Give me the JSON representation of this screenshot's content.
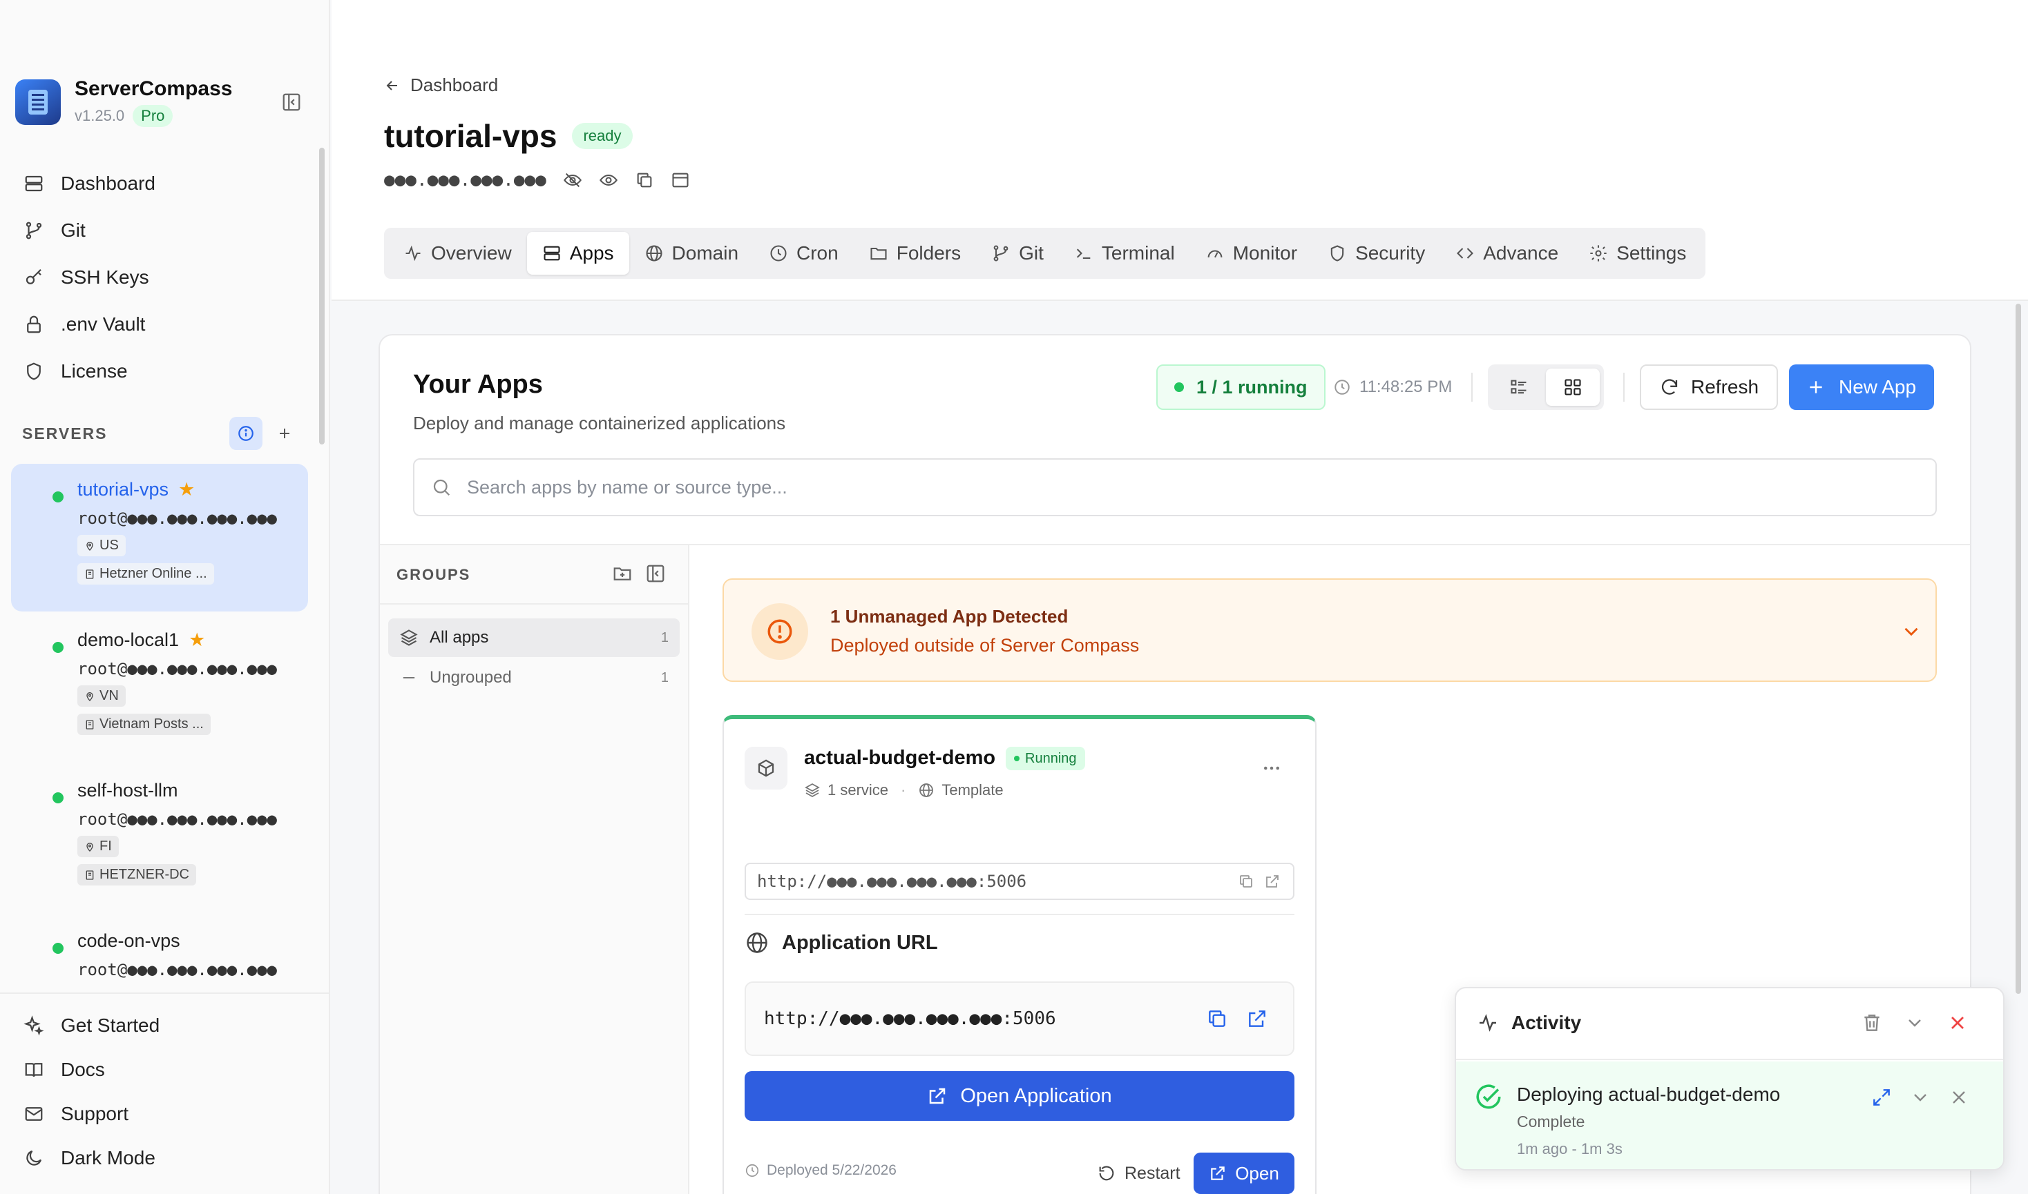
{
  "brand": {
    "name": "ServerCompass",
    "version": "v1.25.0",
    "plan": "Pro"
  },
  "nav": [
    {
      "label": "Dashboard",
      "icon": "dashboard-icon"
    },
    {
      "label": "Git",
      "icon": "git-branch-icon"
    },
    {
      "label": "SSH Keys",
      "icon": "key-icon"
    },
    {
      "label": ".env Vault",
      "icon": "lock-icon"
    },
    {
      "label": "License",
      "icon": "shield-icon"
    }
  ],
  "servers_section": {
    "label": "SERVERS"
  },
  "servers": [
    {
      "name": "tutorial-vps",
      "starred": "★",
      "address": "root@●●●.●●●.●●●.●●●",
      "country": "US",
      "provider": "Hetzner Online ...",
      "status": "online"
    },
    {
      "name": "demo-local1",
      "starred": "★",
      "address": "root@●●●.●●●.●●●.●●●",
      "country": "VN",
      "provider": "Vietnam Posts ...",
      "status": "online"
    },
    {
      "name": "self-host-llm",
      "address": "root@●●●.●●●.●●●.●●●",
      "country": "FI",
      "provider": "HETZNER-DC",
      "status": "online"
    },
    {
      "name": "code-on-vps",
      "address": "root@●●●.●●●.●●●.●●●",
      "status": "online"
    }
  ],
  "bottom_nav": [
    {
      "label": "Get Started",
      "icon": "sparkles-icon"
    },
    {
      "label": "Docs",
      "icon": "book-icon"
    },
    {
      "label": "Support",
      "icon": "mail-icon"
    },
    {
      "label": "Dark Mode",
      "icon": "moon-icon"
    }
  ],
  "header": {
    "back_label": "Dashboard",
    "title": "tutorial-vps",
    "status": "ready",
    "ip_masked": "●●●.●●●.●●●.●●●"
  },
  "tabs": [
    {
      "label": "Overview",
      "icon": "activity-icon"
    },
    {
      "label": "Apps",
      "icon": "server-icon",
      "active": true
    },
    {
      "label": "Domain",
      "icon": "globe-icon"
    },
    {
      "label": "Cron",
      "icon": "clock-icon"
    },
    {
      "label": "Folders",
      "icon": "folder-icon"
    },
    {
      "label": "Git",
      "icon": "git-branch-icon"
    },
    {
      "label": "Terminal",
      "icon": "terminal-icon"
    },
    {
      "label": "Monitor",
      "icon": "gauge-icon"
    },
    {
      "label": "Security",
      "icon": "shield-icon"
    },
    {
      "label": "Advance",
      "icon": "code-icon"
    },
    {
      "label": "Settings",
      "icon": "gear-icon"
    }
  ],
  "apps_panel": {
    "title": "Your Apps",
    "subtitle": "Deploy and manage containerized applications",
    "running": "1 / 1 running",
    "last_updated": "11:48:25 PM",
    "refresh_label": "Refresh",
    "new_app_label": "New App",
    "search_placeholder": "Search apps by name or source type..."
  },
  "groups": {
    "label": "GROUPS",
    "items": [
      {
        "label": "All apps",
        "count": "1"
      },
      {
        "label": "Ungrouped",
        "count": "1"
      }
    ]
  },
  "unmanaged": {
    "title": "1 Unmanaged App Detected",
    "subtitle": "Deployed outside of Server Compass"
  },
  "app": {
    "name": "actual-budget-demo",
    "status": "Running",
    "services": "1 service",
    "source": "Template",
    "internal_url": "http://●●●.●●●.●●●.●●●:5006",
    "app_url_label": "Application URL",
    "app_url": "http://●●●.●●●.●●●.●●●:5006",
    "open_application_label": "Open Application",
    "deployed": "Deployed 5/22/2026",
    "restart_label": "Restart",
    "open_label": "Open"
  },
  "activity": {
    "title": "Activity",
    "item": {
      "name": "Deploying actual-budget-demo",
      "state": "Complete",
      "time": "1m ago  -  1m 3s"
    }
  },
  "colors": {
    "accent": "#3b82f6",
    "primary_button": "#2f5ee0",
    "success": "#22c55e",
    "warning_text": "#c2410c"
  }
}
